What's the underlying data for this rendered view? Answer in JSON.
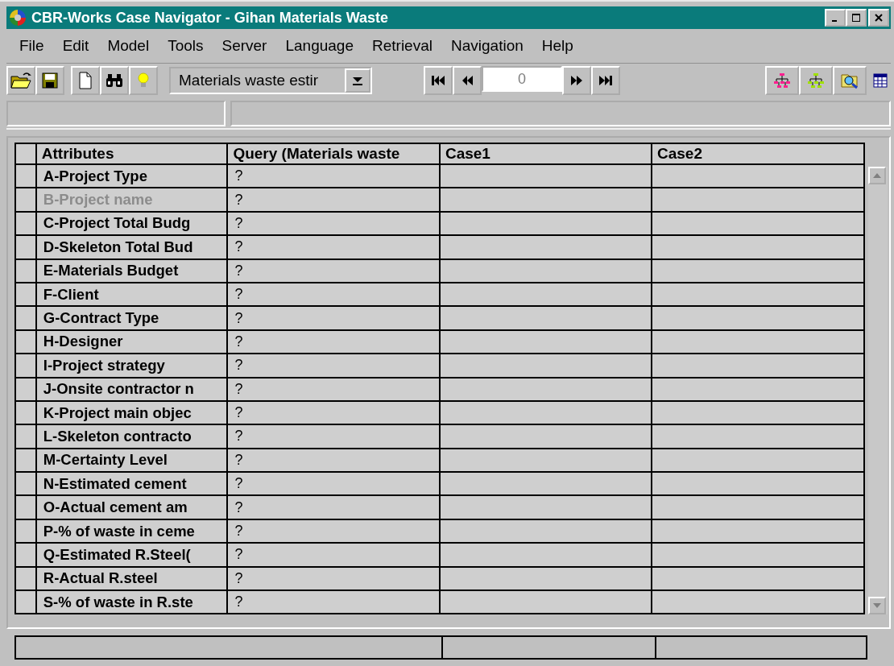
{
  "window": {
    "title": "CBR-Works Case Navigator - Gihan Materials Waste"
  },
  "menu": [
    {
      "label": "File"
    },
    {
      "label": "Edit"
    },
    {
      "label": "Model"
    },
    {
      "label": "Tools"
    },
    {
      "label": "Server"
    },
    {
      "label": "Language"
    },
    {
      "label": "Retrieval"
    },
    {
      "label": "Navigation"
    },
    {
      "label": "Help"
    }
  ],
  "toolbar": {
    "casebase_select": {
      "value": "Materials waste estir"
    },
    "case_index": {
      "value": "0"
    }
  },
  "table": {
    "columns": [
      "Attributes",
      "Query (Materials waste",
      "Case1",
      "Case2"
    ],
    "rows": [
      {
        "attribute": "A-Project Type",
        "query": "?",
        "disabled": false
      },
      {
        "attribute": "B-Project name",
        "query": "?",
        "disabled": true
      },
      {
        "attribute": "C-Project Total Budg",
        "query": "?",
        "disabled": false
      },
      {
        "attribute": "D-Skeleton Total Bud",
        "query": "?",
        "disabled": false
      },
      {
        "attribute": "E-Materials Budget",
        "query": "?",
        "disabled": false
      },
      {
        "attribute": "F-Client",
        "query": "?",
        "disabled": false
      },
      {
        "attribute": "G-Contract Type",
        "query": "?",
        "disabled": false
      },
      {
        "attribute": "H-Designer",
        "query": "?",
        "disabled": false
      },
      {
        "attribute": "I-Project strategy",
        "query": "?",
        "disabled": false
      },
      {
        "attribute": "J-Onsite contractor n",
        "query": "?",
        "disabled": false
      },
      {
        "attribute": "K-Project main objec",
        "query": "?",
        "disabled": false
      },
      {
        "attribute": "L-Skeleton contracto",
        "query": "?",
        "disabled": false
      },
      {
        "attribute": "M-Certainty Level",
        "query": "?",
        "disabled": false
      },
      {
        "attribute": "N-Estimated cement",
        "query": "?",
        "disabled": false
      },
      {
        "attribute": "O-Actual cement am",
        "query": "?",
        "disabled": false
      },
      {
        "attribute": "P-% of waste in ceme",
        "query": "?",
        "disabled": false
      },
      {
        "attribute": "Q-Estimated R.Steel(",
        "query": "?",
        "disabled": false
      },
      {
        "attribute": "R-Actual R.steel",
        "query": "?",
        "disabled": false
      },
      {
        "attribute": "S-% of waste in R.ste",
        "query": "?",
        "disabled": false
      }
    ]
  }
}
